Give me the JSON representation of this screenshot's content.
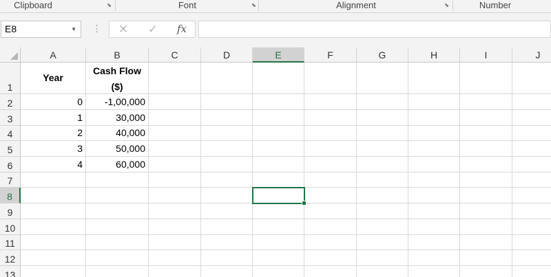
{
  "ribbon": {
    "groups": [
      "Clipboard",
      "Font",
      "Alignment",
      "Number"
    ],
    "launcher_icon": "dialog-launcher-icon"
  },
  "formula_bar": {
    "name_box": "E8",
    "formula": "",
    "fx_label": "fx",
    "cancel_glyph": "✕",
    "enter_glyph": "✓",
    "dots_glyph": "⋮"
  },
  "sheet": {
    "columns": [
      "A",
      "B",
      "C",
      "D",
      "E",
      "F",
      "G",
      "H",
      "I",
      "J"
    ],
    "rows": [
      "1",
      "2",
      "3",
      "4",
      "5",
      "6",
      "7",
      "8",
      "9",
      "10",
      "11",
      "12",
      "13"
    ],
    "selected_cell": "E8",
    "header": {
      "year": "Year",
      "cash_flow_line1": "Cash Flow",
      "cash_flow_line2": "($)"
    },
    "data": [
      {
        "year": "0",
        "cash_flow": "-1,00,000"
      },
      {
        "year": "1",
        "cash_flow": "30,000"
      },
      {
        "year": "2",
        "cash_flow": "40,000"
      },
      {
        "year": "3",
        "cash_flow": "50,000"
      },
      {
        "year": "4",
        "cash_flow": "60,000"
      }
    ]
  },
  "colors": {
    "accent": "#217346",
    "header_bg": "#f3f3f3",
    "gridline": "#d9d9d9"
  }
}
